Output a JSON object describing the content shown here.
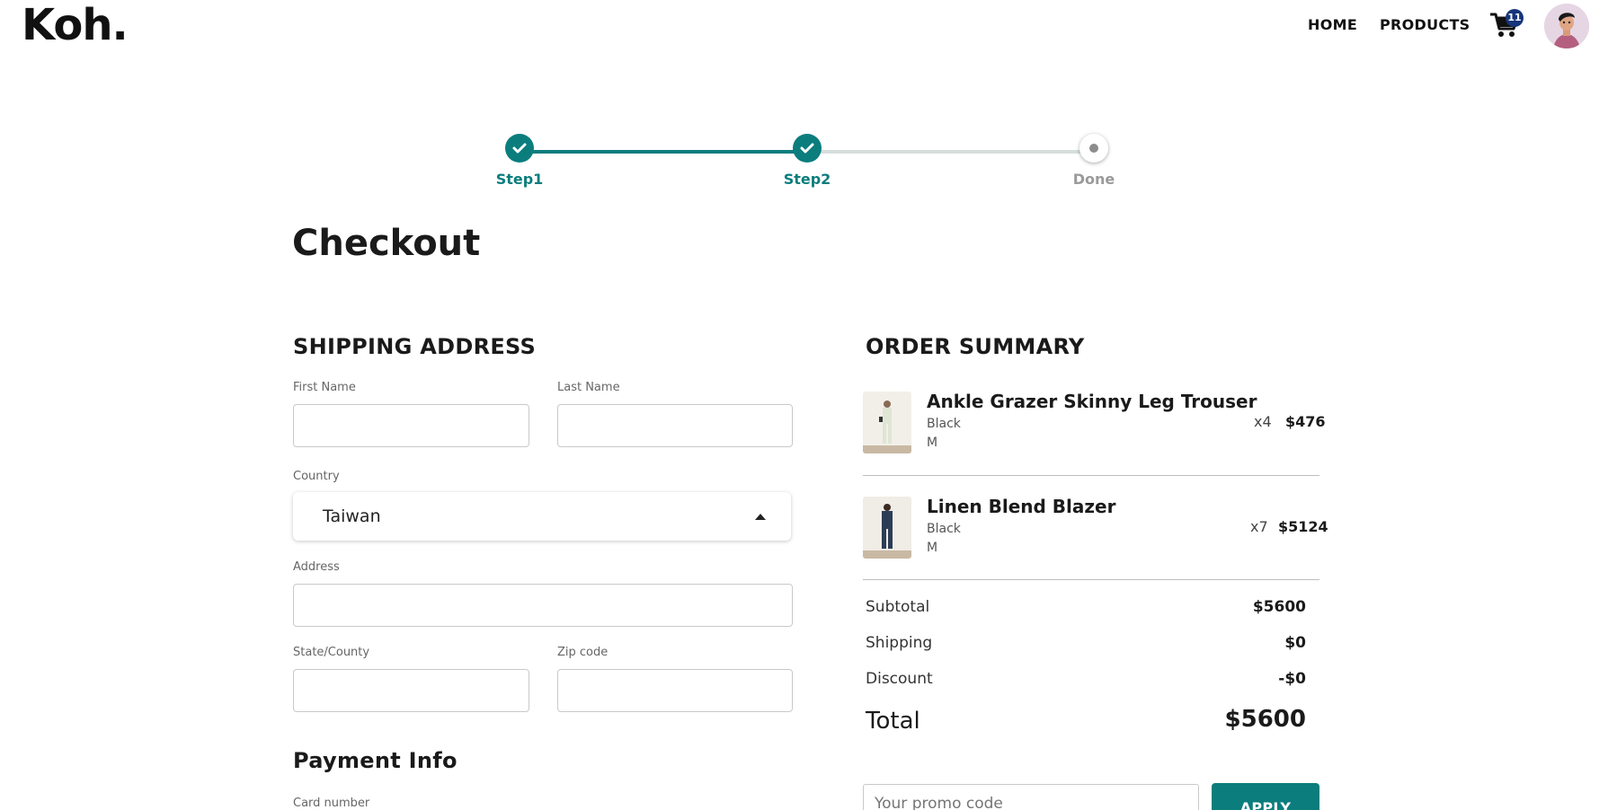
{
  "header": {
    "logo": "Koh.",
    "nav": {
      "home": "HOME",
      "products": "PRODUCTS"
    },
    "cart_count": "11"
  },
  "stepper": {
    "steps": [
      {
        "label": "Step1",
        "state": "done"
      },
      {
        "label": "Step2",
        "state": "done"
      },
      {
        "label": "Done",
        "state": "current"
      }
    ]
  },
  "page_title": "Checkout",
  "shipping": {
    "title": "SHIPPING ADDRESS",
    "first_name_label": "First Name",
    "last_name_label": "Last Name",
    "country_label": "Country",
    "country_value": "Taiwan",
    "address_label": "Address",
    "state_label": "State/County",
    "zip_label": "Zip code"
  },
  "payment": {
    "title": "Payment Info",
    "card_number_label": "Card number"
  },
  "order_summary": {
    "title": "ORDER SUMMARY",
    "items": [
      {
        "name": "Ankle Grazer Skinny Leg Trouser",
        "color": "Black",
        "size": "M",
        "qty": "x4",
        "price": "$476"
      },
      {
        "name": "Linen Blend Blazer",
        "color": "Black",
        "size": "M",
        "qty": "x7",
        "price": "$5124"
      }
    ],
    "subtotal_label": "Subtotal",
    "subtotal_value": "$5600",
    "shipping_label": "Shipping",
    "shipping_value": "$0",
    "discount_label": "Discount",
    "discount_value": "-$0",
    "total_label": "Total",
    "total_value": "$5600",
    "promo_placeholder": "Your promo code",
    "apply_label": "APPLY"
  },
  "colors": {
    "accent": "#0c7d7d",
    "badge": "#17357a"
  }
}
